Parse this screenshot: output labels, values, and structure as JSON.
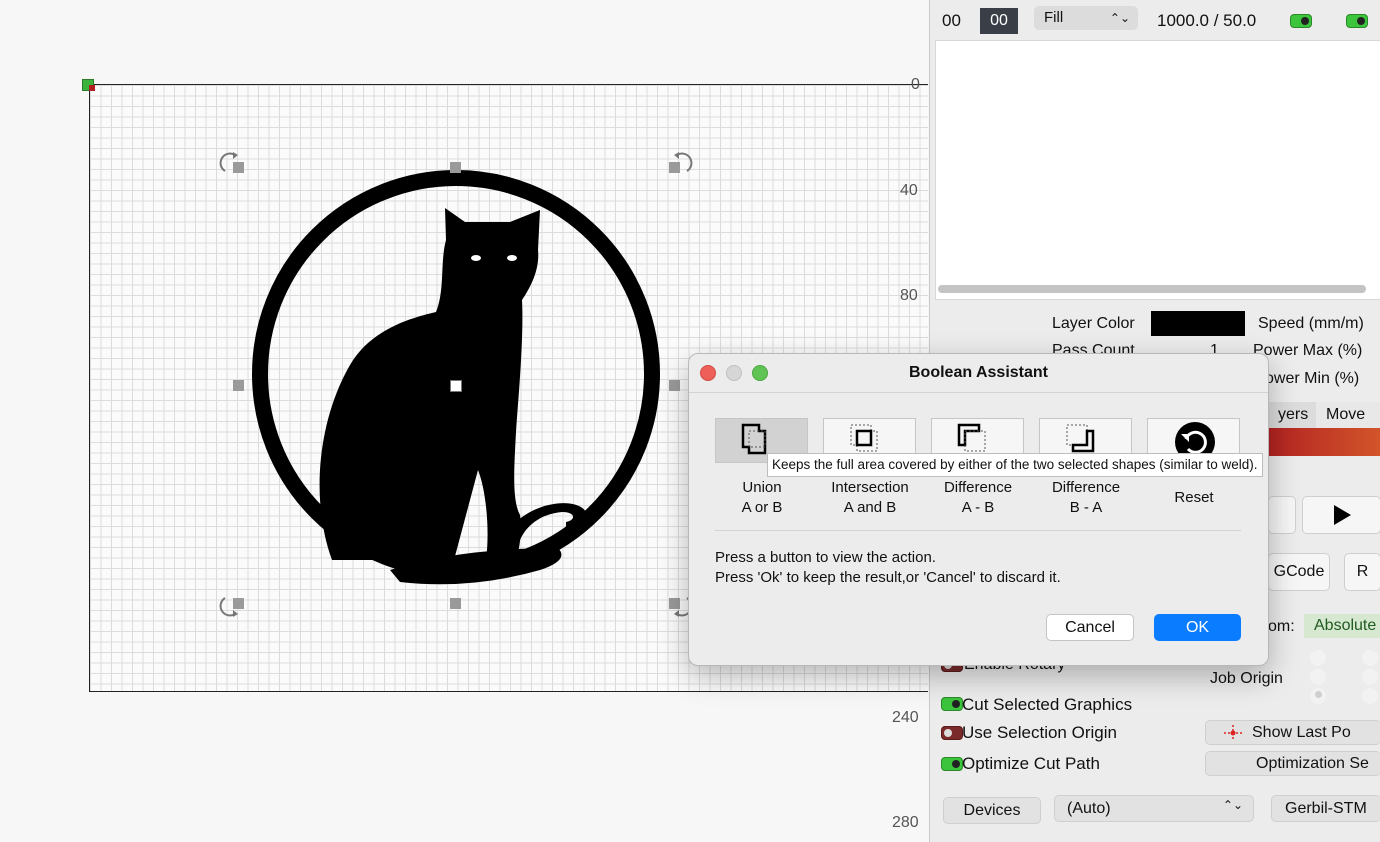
{
  "canvas": {
    "ruler_labels": [
      "0",
      "40",
      "80",
      "240",
      "280"
    ]
  },
  "top_bar": {
    "num_left": "00",
    "num_box": "00",
    "mode_select": "Fill",
    "speed_power": "1000.0 / 50.0"
  },
  "layer_settings": {
    "layer_color_label": "Layer Color",
    "speed_label": "Speed (mm/m)",
    "pass_count_label": "Pass Count",
    "pass_count_value": "1",
    "power_max_label": "Power Max (%)",
    "power_min_label": "ower Min (%)",
    "layer_color_value": "#000000"
  },
  "tabs": {
    "layers": "yers",
    "move": "Move"
  },
  "laser_controls": {
    "gcode_button": "GCode",
    "r_button": "R",
    "start_from_label": "om:",
    "start_from_value": "Absolute",
    "enable_rotary": "Enable Rotary",
    "job_origin": "Job Origin",
    "cut_selected": "Cut Selected Graphics",
    "use_selection_origin": "Use Selection Origin",
    "optimize_cut_path": "Optimize Cut Path",
    "show_last_position": "Show Last Po",
    "optimization_settings": "Optimization Se",
    "devices_button": "Devices",
    "device_select": "(Auto)",
    "controller": "Gerbil-STM"
  },
  "dialog": {
    "title": "Boolean Assistant",
    "buttons": [
      {
        "line1": "Union",
        "line2": "A or B"
      },
      {
        "line1": "Intersection",
        "line2": "A and B"
      },
      {
        "line1": "Difference",
        "line2": "A - B"
      },
      {
        "line1": "Difference",
        "line2": "B - A"
      },
      {
        "line1": "Reset",
        "line2": ""
      }
    ],
    "tooltip": "Keeps the full area covered by either of the two selected shapes (similar to weld).",
    "message_line1": "Press a button to view the action.",
    "message_line2": "Press 'Ok' to keep the result,or 'Cancel' to discard it.",
    "cancel": "Cancel",
    "ok": "OK"
  },
  "colors": {
    "accent": "#0a7cff",
    "toggle_on": "#3cc43c",
    "toggle_off": "#7a2a2a"
  }
}
